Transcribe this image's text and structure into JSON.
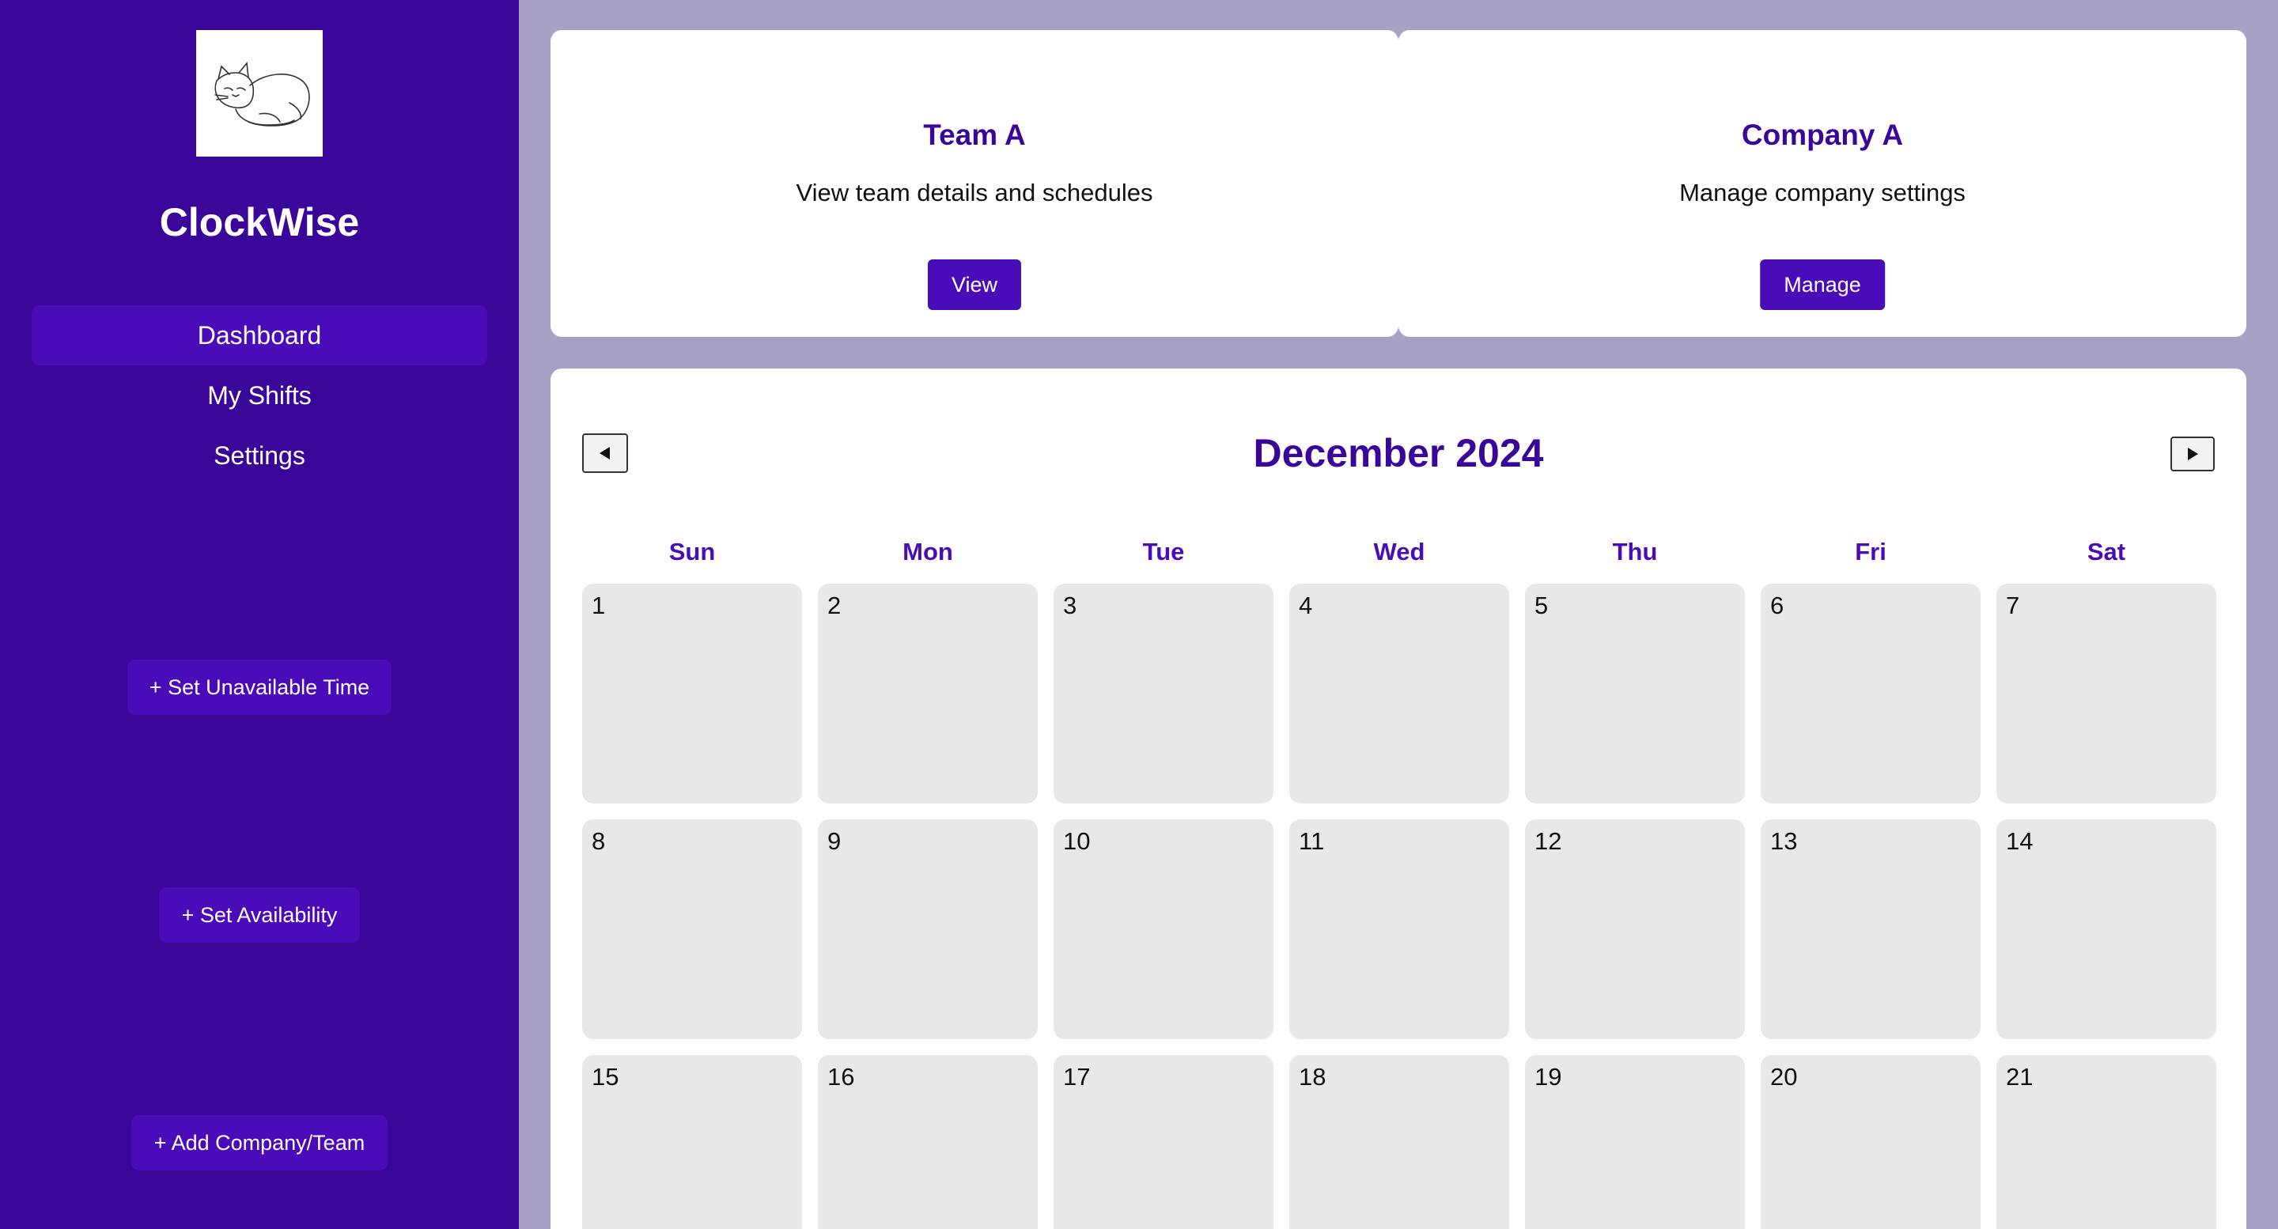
{
  "sidebar": {
    "brand": "ClockWise",
    "logo_icon": "sleeping-cat-logo",
    "nav": [
      {
        "label": "Dashboard",
        "active": true
      },
      {
        "label": "My Shifts",
        "active": false
      },
      {
        "label": "Settings",
        "active": false
      }
    ],
    "actions": {
      "unavailable": "+ Set Unavailable Time",
      "availability": "+ Set Availability",
      "add_company": "+ Add Company/Team"
    }
  },
  "cards": [
    {
      "title": "Team A",
      "description": "View team details and schedules",
      "button": "View"
    },
    {
      "title": "Company A",
      "description": "Manage company settings",
      "button": "Manage"
    }
  ],
  "calendar": {
    "title": "December 2024",
    "prev_icon": "triangle-left-icon",
    "next_icon": "triangle-right-icon",
    "weekdays": [
      "Sun",
      "Mon",
      "Tue",
      "Wed",
      "Thu",
      "Fri",
      "Sat"
    ],
    "days": [
      "1",
      "2",
      "3",
      "4",
      "5",
      "6",
      "7",
      "8",
      "9",
      "10",
      "11",
      "12",
      "13",
      "14",
      "15",
      "16",
      "17",
      "18",
      "19",
      "20",
      "21"
    ]
  },
  "colors": {
    "sidebar_bg": "#3a0599",
    "accent": "#4a0bb8",
    "page_bg": "#a9a0c6",
    "cell_bg": "#e8e8e8"
  }
}
